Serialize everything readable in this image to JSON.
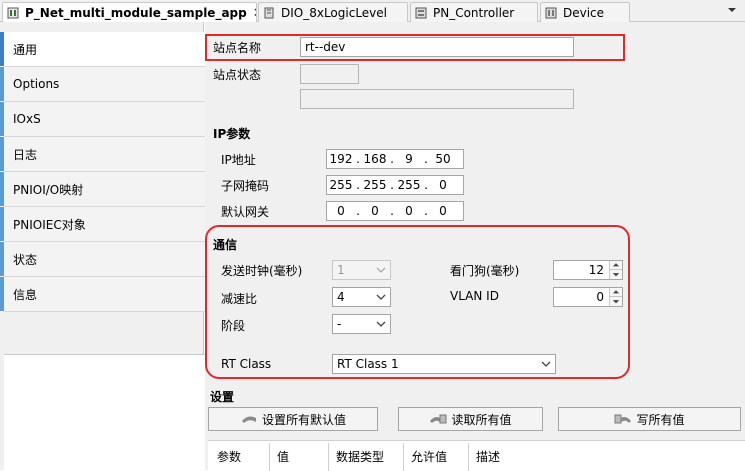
{
  "tabs": [
    {
      "label": "P_Net_multi_module_sample_app",
      "active": true,
      "closable": true,
      "icon": "pn-device-icon"
    },
    {
      "label": "DIO_8xLogicLevel",
      "active": false,
      "icon": "module-icon"
    },
    {
      "label": "PN_Controller",
      "active": false,
      "icon": "controller-icon"
    },
    {
      "label": "Device",
      "active": false,
      "icon": "device-icon"
    }
  ],
  "nav": [
    {
      "label": "通用",
      "active": true
    },
    {
      "label": "Options"
    },
    {
      "label": "IOxS"
    },
    {
      "label": "日志"
    },
    {
      "label": "PNIOI/O映射"
    },
    {
      "label": "PNIOIEC对象"
    },
    {
      "label": "状态"
    },
    {
      "label": "信息"
    }
  ],
  "general": {
    "station_name_label": "站点名称",
    "station_name_value": "rt--dev",
    "station_status_label": "站点状态",
    "station_status_value": "",
    "station_status_text": ""
  },
  "ip": {
    "section_title": "IP参数",
    "ip_label": "IP地址",
    "ip_octets": [
      "192",
      "168",
      "9",
      "50"
    ],
    "subnet_label": "子网掩码",
    "subnet_octets": [
      "255",
      "255",
      "255",
      "0"
    ],
    "gateway_label": "默认网关",
    "gateway_octets": [
      "0",
      "0",
      "0",
      "0"
    ]
  },
  "comm": {
    "section_title": "通信",
    "send_clock_label": "发送时钟(毫秒)",
    "send_clock_value": "1",
    "reduction_label": "减速比",
    "reduction_value": "4",
    "phase_label": "阶段",
    "phase_value": "-",
    "watchdog_label": "看门狗(毫秒)",
    "watchdog_value": "12",
    "vlan_label": "VLAN ID",
    "vlan_value": "0",
    "rtclass_label": "RT Class",
    "rtclass_value": "RT Class 1"
  },
  "settings": {
    "section_title": "设置",
    "btn_defaults": "设置所有默认值",
    "btn_read": "读取所有值",
    "btn_write": "写所有值",
    "columns": [
      "参数",
      "值",
      "数据类型",
      "允许值",
      "描述"
    ]
  },
  "colors": {
    "highlight_border": "#e0292b",
    "nav_accent": "#5b9bd5"
  }
}
